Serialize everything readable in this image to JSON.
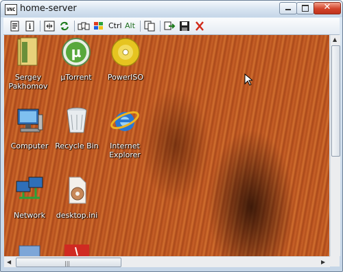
{
  "window": {
    "title": "home-server",
    "app_icon_text": "VNC",
    "close_glyph": "✕"
  },
  "toolbar": {
    "items": [
      {
        "name": "options-icon"
      },
      {
        "name": "connection-info-icon"
      },
      {
        "name": "fullscreen-icon"
      },
      {
        "name": "refresh-icon"
      },
      {
        "name": "ctrl-alt-del-icon"
      },
      {
        "name": "start-menu-icon"
      },
      {
        "name": "ctrl-key",
        "label": "Ctrl"
      },
      {
        "name": "alt-key",
        "label": "Alt"
      },
      {
        "name": "clipboard-icon"
      },
      {
        "name": "transfer-files-icon"
      },
      {
        "name": "save-icon"
      },
      {
        "name": "disconnect-icon"
      }
    ]
  },
  "desktop_icons": [
    {
      "label": "Sergey Pakhomov",
      "icon": "folder-icon"
    },
    {
      "label": "µTorrent",
      "icon": "utorrent-icon"
    },
    {
      "label": "PowerISO",
      "icon": "poweriso-icon"
    },
    {
      "label": "Computer",
      "icon": "computer-icon"
    },
    {
      "label": "Recycle Bin",
      "icon": "recycle-bin-icon"
    },
    {
      "label": "Internet Explorer",
      "icon": "internet-explorer-icon"
    },
    {
      "label": "Network",
      "icon": "network-icon"
    },
    {
      "label": "desktop.ini",
      "icon": "settings-file-icon"
    }
  ],
  "colors": {
    "titlebar": "#d6e3f0",
    "close_button": "#d2432a",
    "desktop_wood": "#c0581f"
  }
}
